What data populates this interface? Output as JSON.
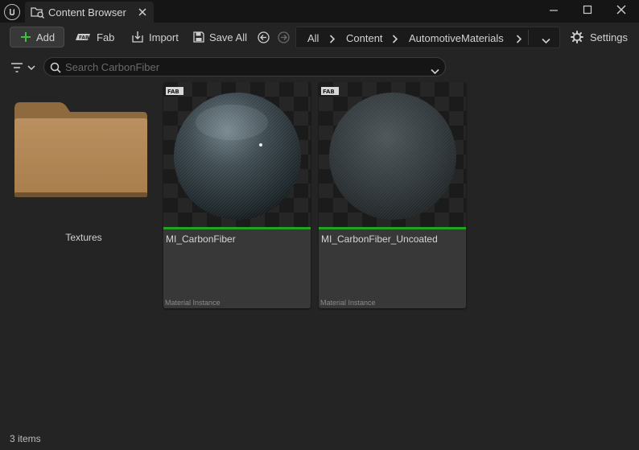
{
  "window": {
    "tab_title": "Content Browser",
    "icons": [
      "unreal-logo-icon",
      "content-browser-icon",
      "close-icon",
      "minimize-icon",
      "maximize-icon",
      "close-window-icon"
    ]
  },
  "toolbar": {
    "add_label": "Add",
    "fab_label": "Fab",
    "import_label": "Import",
    "save_all_label": "Save All",
    "settings_label": "Settings",
    "add_accent": "#3fbf3f"
  },
  "breadcrumb": {
    "items": [
      "All",
      "Content",
      "AutomotiveMaterials"
    ]
  },
  "search": {
    "placeholder": "Search CarbonFiber",
    "value": ""
  },
  "assets": [
    {
      "name": "Textures",
      "kind": "folder",
      "color": "#b48a57"
    },
    {
      "name": "MI_CarbonFiber",
      "type": "Material Instance",
      "badge": "FAB",
      "bar_color": "#22a322"
    },
    {
      "name": "MI_CarbonFiber_Uncoated",
      "type": "Material Instance",
      "badge": "FAB",
      "bar_color": "#22a322"
    }
  ],
  "status": {
    "item_count": "3 items"
  }
}
